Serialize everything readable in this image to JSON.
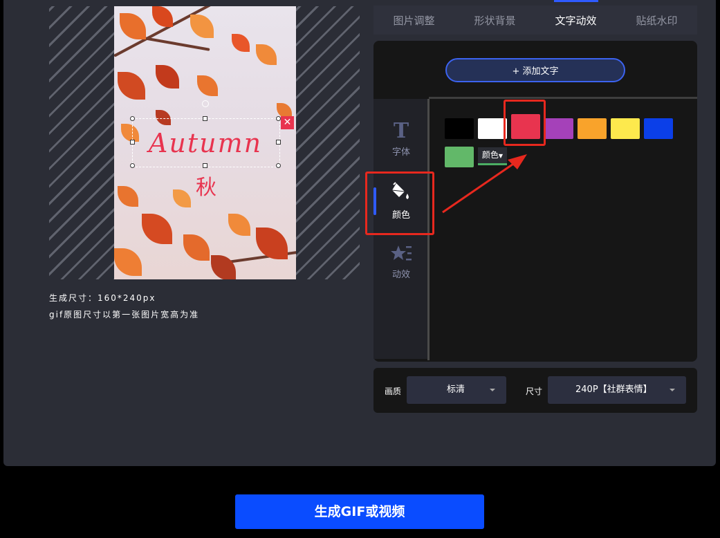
{
  "preview": {
    "overlay_text_main": "Autumn",
    "overlay_text_sub": "秋",
    "close_glyph": "✕",
    "size_line": "生成尺寸：160*240px",
    "note_line": "gif原图尺寸以第一张图片宽高为准"
  },
  "tabs": [
    {
      "label": "图片调整"
    },
    {
      "label": "形状背景"
    },
    {
      "label": "文字动效",
      "active": true
    },
    {
      "label": "贴纸水印"
    }
  ],
  "editor": {
    "add_text_label": "+ 添加文字",
    "sidenav": [
      {
        "label": "字体",
        "icon": "font-T-icon"
      },
      {
        "label": "颜色",
        "icon": "paint-bucket-icon",
        "active": true
      },
      {
        "label": "动效",
        "icon": "star-effect-icon"
      }
    ],
    "swatches": [
      "#000000",
      "#ffffff",
      "#e8344f",
      "#a541b9",
      "#f9a32b",
      "#fde94d",
      "#0b3fe8",
      "#62b869"
    ],
    "selected_swatch": "#e8344f",
    "color_dropdown_label": "颜色"
  },
  "settings": {
    "quality_label": "画质",
    "quality_value": "标清",
    "size_label": "尺寸",
    "size_value": "240P【社群表情】"
  },
  "generate_button": "生成GIF或视频",
  "colors": {
    "accent": "#2f5bff",
    "button_blue": "#0a4cff",
    "annotation_red": "#e7281e",
    "panel_bg": "#2b2d36"
  }
}
